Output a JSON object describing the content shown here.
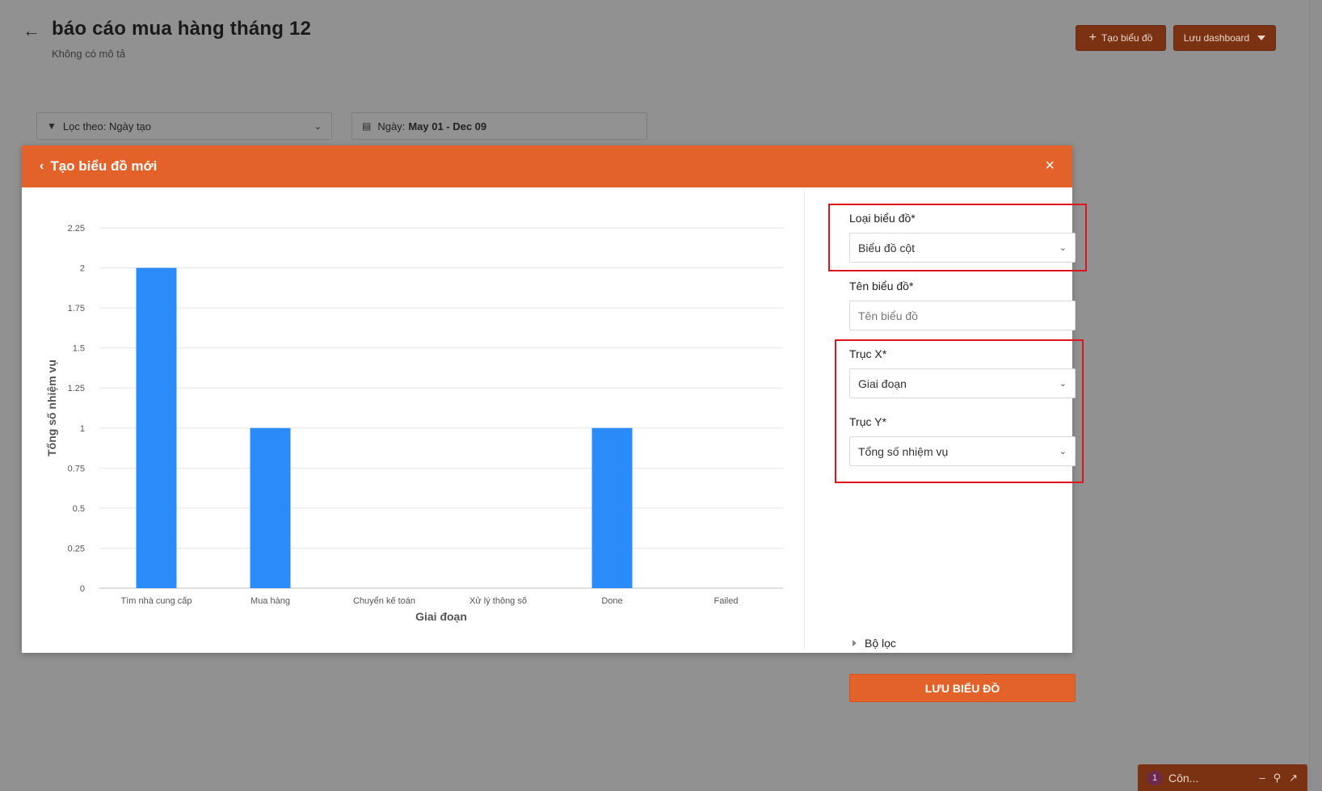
{
  "page": {
    "title": "báo cáo mua hàng tháng 12",
    "subtitle": "Không có mô tả",
    "create_chart_label": "Tạo biểu đồ",
    "save_dashboard_label": "Lưu dashboard",
    "filter_label": "Lọc theo: Ngày tạo",
    "date_label": "Ngày:",
    "date_value": "May 01 - Dec 09"
  },
  "modal": {
    "title": "Tạo biểu đồ mới"
  },
  "form": {
    "chart_type_label": "Loại biểu đồ*",
    "chart_type_value": "Biểu đồ cột",
    "chart_name_label": "Tên biểu đồ*",
    "chart_name_placeholder": "Tên biểu đồ",
    "x_axis_label": "Trục X*",
    "x_axis_value": "Giai đoạn",
    "y_axis_label": "Trục Y*",
    "y_axis_value": "Tổng số nhiệm vụ",
    "filter_toggle_label": "Bộ lọc",
    "save_button_label": "LƯU BIỂU ĐỒ"
  },
  "chat": {
    "badge": "1",
    "label": "Côn..."
  },
  "colors": {
    "accent": "#e3622a",
    "bar": "#2b8cf9",
    "highlight": "#e0141b"
  },
  "chart_data": {
    "type": "bar",
    "categories": [
      "Tìm nhà cung cấp",
      "Mua hàng",
      "Chuyển kế toán",
      "Xử lý thông số",
      "Done",
      "Failed"
    ],
    "values": [
      2,
      1,
      0,
      0,
      1,
      0
    ],
    "xlabel": "Giai đoạn",
    "ylabel": "Tổng số nhiệm vụ",
    "ylim": [
      0,
      2.25
    ],
    "yticks": [
      "0",
      "0.25",
      "0.5",
      "0.75",
      "1",
      "1.25",
      "1.5",
      "1.75",
      "2",
      "2.25"
    ],
    "grid": true
  }
}
